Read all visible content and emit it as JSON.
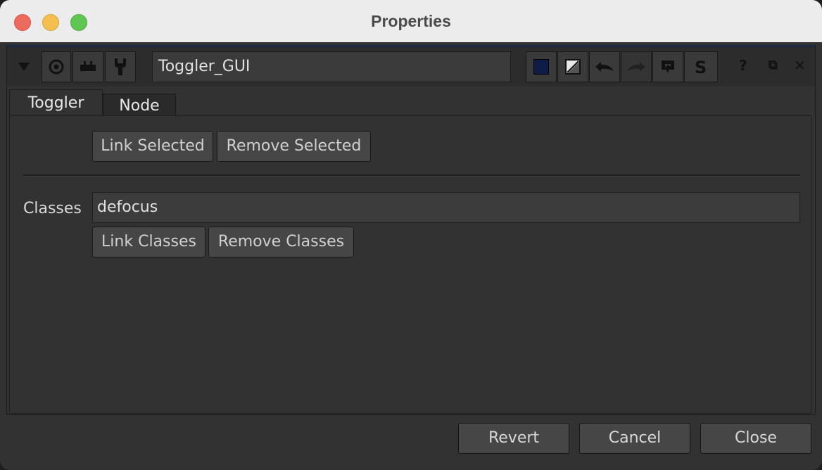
{
  "window": {
    "title": "Properties"
  },
  "toolbar": {
    "node_name": "Toggler_GUI",
    "help_label": "?",
    "float_label": "⧉",
    "close_label": "✕",
    "color_swatch": "#0e1d47"
  },
  "tabs": [
    {
      "label": "Toggler"
    },
    {
      "label": "Node"
    }
  ],
  "toggler": {
    "link_selected_label": "Link Selected",
    "remove_selected_label": "Remove Selected",
    "classes_label": "Classes",
    "classes_value": "defocus",
    "link_classes_label": "Link Classes",
    "remove_classes_label": "Remove Classes"
  },
  "footer": {
    "revert_label": "Revert",
    "cancel_label": "Cancel",
    "close_label": "Close"
  }
}
